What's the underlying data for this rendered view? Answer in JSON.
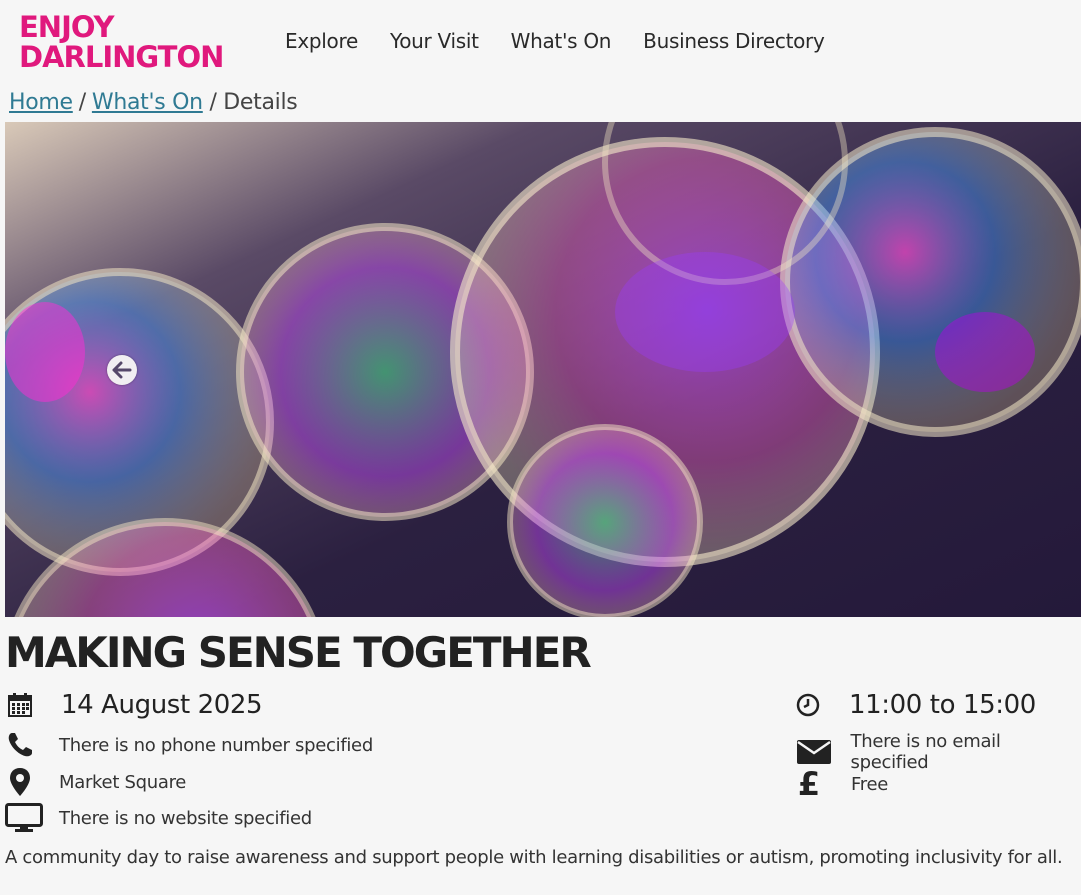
{
  "brand": {
    "line1": "ENJOY",
    "line2": "DARLINGTON"
  },
  "nav": [
    "Explore",
    "Your Visit",
    "What's On",
    "Business Directory"
  ],
  "breadcrumb": {
    "home": "Home",
    "section": "What's On",
    "current": "/ Details",
    "sep": "/"
  },
  "event": {
    "title": "MAKING SENSE TOGETHER",
    "date": "14 August 2025",
    "time": "11:00 to 15:00",
    "phone": "There is no phone number specified",
    "email": "There is no email specified",
    "location": "Market Square",
    "price": "Free",
    "website": "There is no website specified",
    "description": "A community day to raise awareness and support people with learning disabilities or autism, promoting inclusivity for all."
  },
  "icons": {
    "date": "calendar-icon",
    "time": "clock-icon",
    "phone": "phone-icon",
    "email": "envelope-icon",
    "location": "map-pin-icon",
    "price": "pound-icon",
    "website": "monitor-icon",
    "carousel_prev": "arrow-left-icon"
  },
  "colors": {
    "brand": "#e0197d",
    "link": "#2f7a93",
    "text": "#222222",
    "background": "#f6f6f6"
  }
}
